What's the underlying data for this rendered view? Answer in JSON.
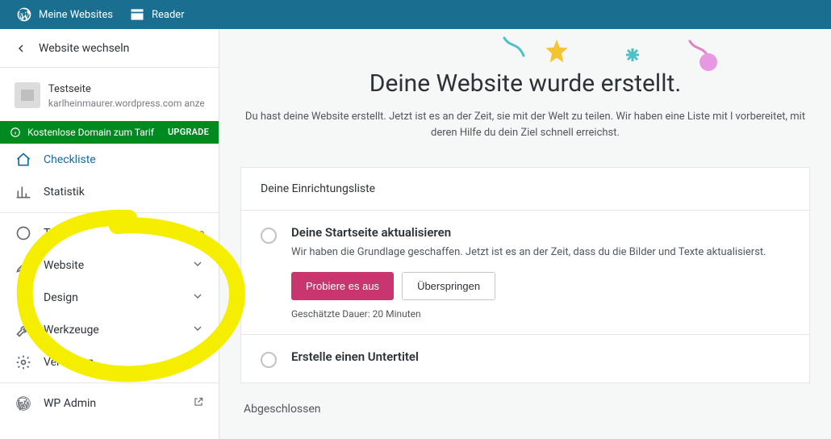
{
  "masterbar": {
    "mysites": "Meine Websites",
    "reader": "Reader"
  },
  "sidebar": {
    "back": "Website wechseln",
    "site": {
      "title": "Testseite",
      "url": "karlheinmaurer.wordpress.com anze"
    },
    "upgrade": {
      "text": "Kostenlose Domain zum Tarif",
      "cta": "UPGRADE"
    },
    "items": {
      "checklist": "Checkliste",
      "stats": "Statistik",
      "plan": "Tarif",
      "plan_badge": "Free",
      "site_menu": "Website",
      "design": "Design",
      "tools": "Werkzeuge",
      "manage": "Verwalten",
      "wpadmin": "WP Admin"
    }
  },
  "hero": {
    "title": "Deine Website wurde erstellt.",
    "subtitle": "Du hast deine Website erstellt. Jetzt ist es an der Zeit, sie mit der Welt zu teilen. Wir haben eine Liste mit l vorbereitet, mit deren Hilfe du dein Ziel schnell erreichst."
  },
  "setup": {
    "header": "Deine Einrichtungsliste",
    "task1": {
      "title": "Deine Startseite aktualisieren",
      "desc": "Wir haben die Grundlage geschaffen. Jetzt ist es an der Zeit, dass du die Bilder und Texte aktualisierst.",
      "primary": "Probiere es aus",
      "secondary": "Überspringen",
      "eta": "Geschätzte Dauer: 20 Minuten"
    },
    "task2": {
      "title": "Erstelle einen Untertitel"
    },
    "completed": "Abgeschlossen"
  }
}
